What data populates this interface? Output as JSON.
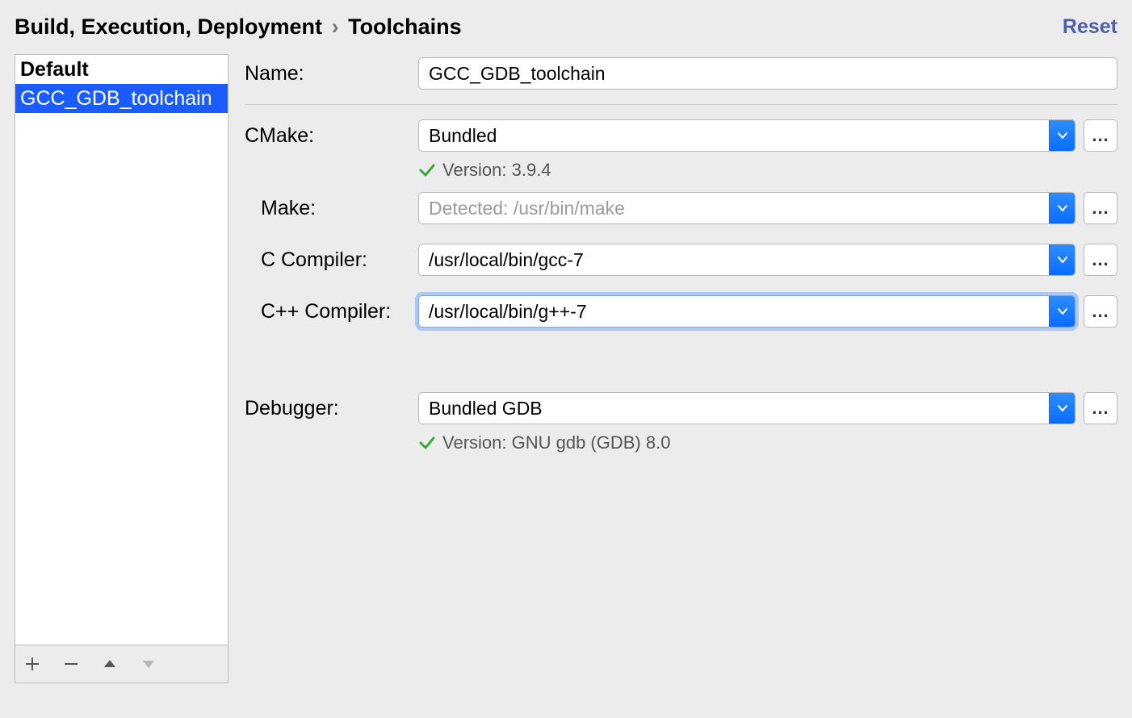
{
  "breadcrumb": {
    "segment1": "Build, Execution, Deployment",
    "segment2": "Toolchains"
  },
  "reset_label": "Reset",
  "list": {
    "items": [
      {
        "label": "Default",
        "bold": true,
        "selected": false
      },
      {
        "label": "GCC_GDB_toolchain",
        "bold": false,
        "selected": true
      }
    ]
  },
  "form": {
    "name_label": "Name:",
    "name_value": "GCC_GDB_toolchain",
    "cmake_label": "CMake:",
    "cmake_value": "Bundled",
    "cmake_version": "Version: 3.9.4",
    "make_label": "Make:",
    "make_placeholder": "Detected: /usr/bin/make",
    "c_compiler_label": "C Compiler:",
    "c_compiler_value": "/usr/local/bin/gcc-7",
    "cpp_compiler_label": "C++ Compiler:",
    "cpp_compiler_value": "/usr/local/bin/g++-7",
    "debugger_label": "Debugger:",
    "debugger_value": "Bundled GDB",
    "debugger_version": "Version: GNU gdb (GDB) 8.0"
  },
  "browse_dots": "..."
}
